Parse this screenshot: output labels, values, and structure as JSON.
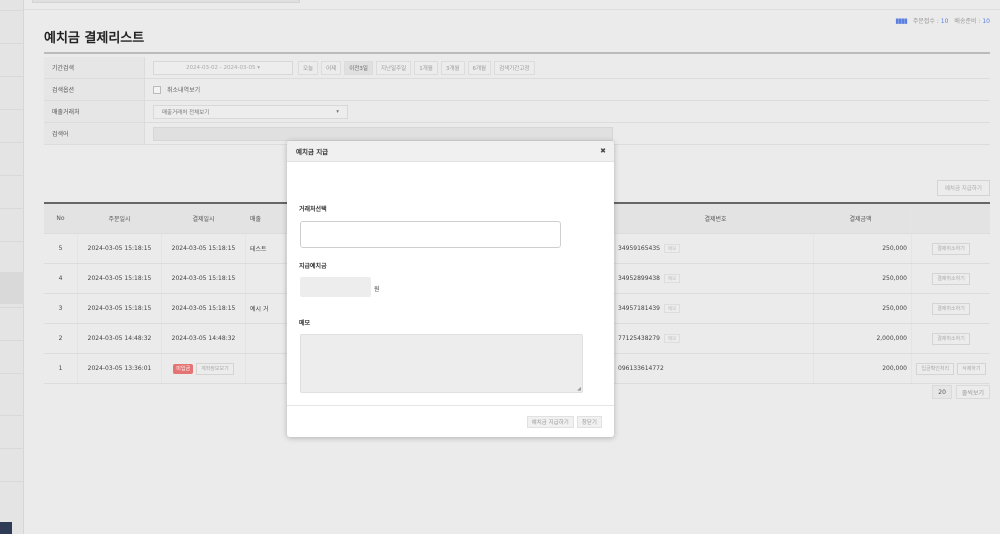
{
  "page": {
    "title": "예치금 결제리스트",
    "summary": {
      "order_count_label": "주문접수",
      "order_count": "10",
      "delivery_label": "배송준비",
      "delivery_count": "10"
    }
  },
  "filter": {
    "period_label": "기간검색",
    "date_range": "2024-03-02 - 2024-03-05",
    "quick_ranges": [
      "오늘",
      "어제",
      "이전3일",
      "지난일주일",
      "1개월",
      "3개월",
      "6개월",
      "검색기간고정"
    ],
    "quick_active": "이전3일",
    "option_label": "검색옵션",
    "cancel_checkbox_label": "취소내역보기",
    "seller_label": "매출거래처",
    "seller_select": "매출거래처 전체보기",
    "keyword_label": "검색어"
  },
  "actions": {
    "pay_deposit": "예치금 지급하기"
  },
  "table": {
    "columns": [
      "No",
      "주문일시",
      "결제일시",
      "매출",
      "결제번호",
      "결제금액",
      ""
    ],
    "memo_tag": "메모",
    "rows": [
      {
        "no": "5",
        "order_time": "2024-03-05 15:18:15",
        "pay_time": "2024-03-05 15:18:15",
        "store": "테스트",
        "pay_no": "3495916543S",
        "has_memo": true,
        "amount": "250,000",
        "actions": [
          "결제취소하기"
        ]
      },
      {
        "no": "4",
        "order_time": "2024-03-05 15:18:15",
        "pay_time": "2024-03-05 15:18:15",
        "store": "",
        "pay_no": "34952899438",
        "has_memo": true,
        "amount": "250,000",
        "actions": [
          "결제취소하기"
        ]
      },
      {
        "no": "3",
        "order_time": "2024-03-05 15:18:15",
        "pay_time": "2024-03-05 15:18:15",
        "store": "예시 거",
        "pay_no": "34957181439",
        "has_memo": true,
        "amount": "250,000",
        "actions": [
          "결제취소하기"
        ]
      },
      {
        "no": "2",
        "order_time": "2024-03-05 14:48:32",
        "pay_time": "2024-03-05 14:48:32",
        "store": "",
        "pay_no": "77125438279",
        "has_memo": true,
        "amount": "2,000,000",
        "actions": [
          "결제취소하기"
        ]
      },
      {
        "no": "1",
        "order_time": "2024-03-05 13:36:01",
        "pay_status_badge": "미입금",
        "pay_status_link": "계좌정보보기",
        "store": "",
        "pay_no": "096133614772",
        "has_memo": false,
        "amount": "200,000",
        "actions": [
          "입금확인처리",
          "삭제하기"
        ]
      }
    ]
  },
  "pager": {
    "per_page": "20",
    "more": "줄씩보기"
  },
  "modal": {
    "title": "예치금 지급",
    "store_label": "거래처선택",
    "amount_label": "지급예치금",
    "currency": "원",
    "memo_label": "메모",
    "submit": "예치금 지급하기",
    "close": "창닫기"
  },
  "colors": {
    "accent": "#5b7fe0",
    "badge_red": "#e57373",
    "sidebar_dark": "#2d3b55"
  }
}
